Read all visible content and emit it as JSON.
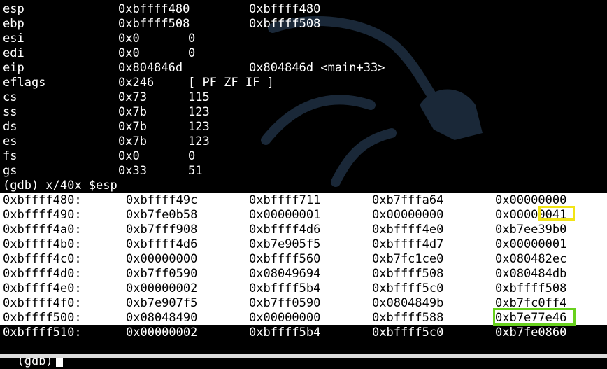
{
  "registers": [
    {
      "name": "esp",
      "hex": "0xbffff480",
      "val": "0xbffff480"
    },
    {
      "name": "ebp",
      "hex": "0xbffff508",
      "val": "0xbffff508"
    },
    {
      "name": "esi",
      "hex": "0x0",
      "val": "0"
    },
    {
      "name": "edi",
      "hex": "0x0",
      "val": "0"
    },
    {
      "name": "eip",
      "hex": "0x804846d",
      "val": "0x804846d <main+33>"
    },
    {
      "name": "eflags",
      "hex": "0x246",
      "val": "[ PF ZF IF ]"
    },
    {
      "name": "cs",
      "hex": "0x73",
      "val": "115"
    },
    {
      "name": "ss",
      "hex": "0x7b",
      "val": "123"
    },
    {
      "name": "ds",
      "hex": "0x7b",
      "val": "123"
    },
    {
      "name": "es",
      "hex": "0x7b",
      "val": "123"
    },
    {
      "name": "fs",
      "hex": "0x0",
      "val": "0"
    },
    {
      "name": "gs",
      "hex": "0x33",
      "val": "51"
    }
  ],
  "command": "(gdb) x/40x $esp",
  "memory": [
    {
      "addr": "0xbffff480:",
      "w": [
        "0xbffff49c",
        "0xbffff711",
        "0xb7fffa64",
        "0x00000000"
      ]
    },
    {
      "addr": "0xbffff490:",
      "w": [
        "0xb7fe0b58",
        "0x00000001",
        "0x00000000",
        "0x00000041"
      ]
    },
    {
      "addr": "0xbffff4a0:",
      "w": [
        "0xb7fff908",
        "0xbffff4d6",
        "0xbffff4e0",
        "0xb7ee39b0"
      ]
    },
    {
      "addr": "0xbffff4b0:",
      "w": [
        "0xbffff4d6",
        "0xb7e905f5",
        "0xbffff4d7",
        "0x00000001"
      ]
    },
    {
      "addr": "0xbffff4c0:",
      "w": [
        "0x00000000",
        "0xbffff560",
        "0xb7fc1ce0",
        "0x080482ec"
      ]
    },
    {
      "addr": "0xbffff4d0:",
      "w": [
        "0xb7ff0590",
        "0x08049694",
        "0xbffff508",
        "0x080484db"
      ]
    },
    {
      "addr": "0xbffff4e0:",
      "w": [
        "0x00000002",
        "0xbffff5b4",
        "0xbffff5c0",
        "0xbffff508"
      ]
    },
    {
      "addr": "0xbffff4f0:",
      "w": [
        "0xb7e907f5",
        "0xb7ff0590",
        "0x0804849b",
        "0xb7fc0ff4"
      ]
    },
    {
      "addr": "0xbffff500:",
      "w": [
        "0x08048490",
        "0x00000000",
        "0xbffff588",
        "0xb7e77e46"
      ]
    },
    {
      "addr": "0xbffff510:",
      "w": [
        "0x00000002",
        "0xbffff5b4",
        "0xbffff5c0",
        "0xb7fe0860"
      ]
    }
  ],
  "prompt": "(gdb)",
  "colors": {
    "highlight_yellow": "#f2e415",
    "highlight_green": "#68d11d",
    "background": "#000000",
    "selection_bg": "#ffffff"
  }
}
